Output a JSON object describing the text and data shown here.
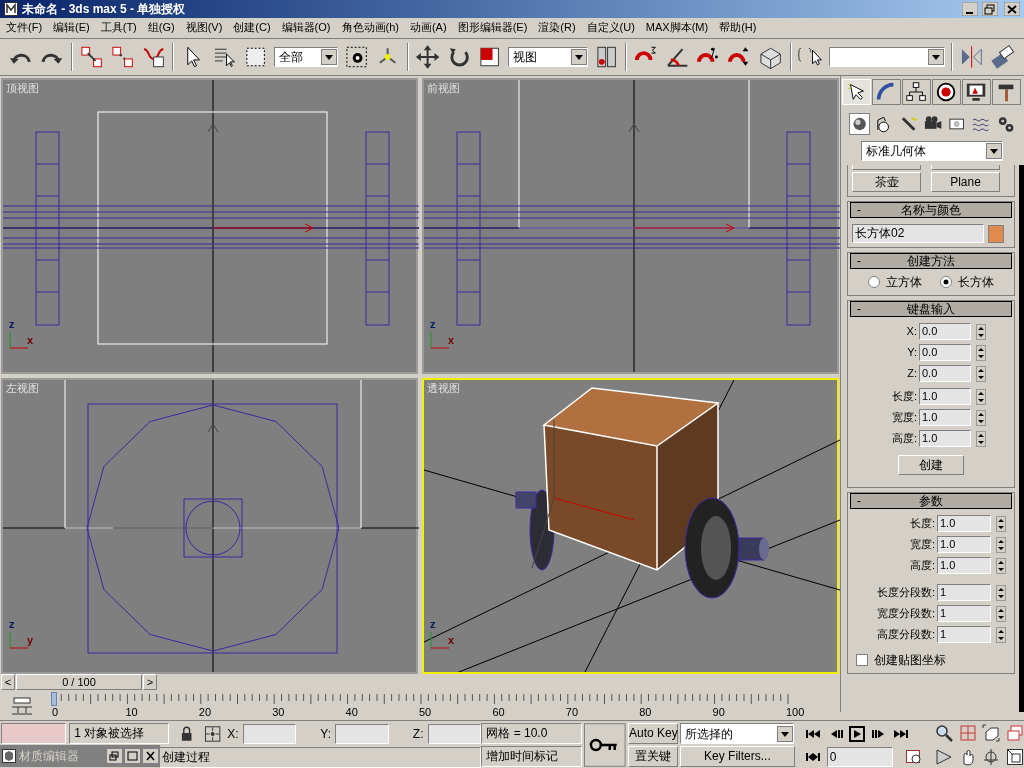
{
  "window": {
    "title": "未命名 - 3ds max 5 - 单独授权"
  },
  "menu": [
    "文件(F)",
    "编辑(E)",
    "工具(T)",
    "组(G)",
    "视图(V)",
    "创建(C)",
    "编辑器(O)",
    "角色动画(h)",
    "动画(A)",
    "图形编辑器(E)",
    "渲染(R)",
    "自定义(U)",
    "MAX脚本(M)",
    "帮助(H)"
  ],
  "toolbar": {
    "selection_filter": "全部",
    "reference_coord": "视图"
  },
  "viewports": [
    {
      "kind": "top",
      "label": "顶视图",
      "active": false,
      "axis_labels": [
        "z",
        "x"
      ]
    },
    {
      "kind": "front",
      "label": "前视图",
      "active": false,
      "axis_labels": [
        "z",
        "x"
      ]
    },
    {
      "kind": "left",
      "label": "左视图",
      "active": false,
      "axis_labels": [
        "z",
        "y"
      ]
    },
    {
      "kind": "perspective",
      "label": "透视图",
      "active": true,
      "axis_labels": [
        "z",
        "x"
      ]
    }
  ],
  "command_panel": {
    "tabs": [
      {
        "selected": true
      },
      {
        "selected": false
      },
      {
        "selected": false
      },
      {
        "selected": false
      },
      {
        "selected": false
      },
      {
        "selected": false
      }
    ],
    "object_types": [
      {
        "selected": true
      },
      {
        "selected": false
      },
      {
        "selected": false
      },
      {
        "selected": false
      },
      {
        "selected": false
      },
      {
        "selected": false
      },
      {
        "selected": false
      }
    ],
    "category": "标准几何体",
    "object_buttons": [
      "茶壶",
      "Plane"
    ],
    "name_rollout": {
      "toggle": "-",
      "title": "名称与颜色",
      "name": "长方体02",
      "color": "#e08a4e"
    },
    "method_rollout": {
      "toggle": "-",
      "title": "创建方法",
      "options": [
        {
          "label": "立方体",
          "selected": false
        },
        {
          "label": "长方体",
          "selected": true
        }
      ]
    },
    "keyboard_rollout": {
      "toggle": "-",
      "title": "键盘输入",
      "fields": [
        {
          "label": "X:",
          "value": "0.0"
        },
        {
          "label": "Y:",
          "value": "0.0"
        },
        {
          "label": "Z:",
          "value": "0.0"
        }
      ],
      "sizes": [
        {
          "label": "长度:",
          "value": "1.0"
        },
        {
          "label": "宽度:",
          "value": "1.0"
        },
        {
          "label": "高度:",
          "value": "1.0"
        }
      ],
      "button": "创建"
    },
    "params_rollout": {
      "toggle": "-",
      "title": "参数",
      "sizes": [
        {
          "label": "长度:",
          "value": "1.0"
        },
        {
          "label": "宽度:",
          "value": "1.0"
        },
        {
          "label": "高度:",
          "value": "1.0"
        }
      ],
      "segments": [
        {
          "label": "长度分段数:",
          "value": "1"
        },
        {
          "label": "宽度分段数:",
          "value": "1"
        },
        {
          "label": "高度分段数:",
          "value": "1"
        }
      ],
      "mapping": {
        "label": "创建贴图坐标",
        "checked": false
      }
    }
  },
  "time_slider": {
    "prev": "<",
    "position": "0 / 100",
    "next": ">"
  },
  "track_labels": [
    "0",
    "10",
    "20",
    "30",
    "40",
    "50",
    "60",
    "70",
    "80",
    "90",
    "100"
  ],
  "status": {
    "selection": "1 对象被选择",
    "x_label": "X:",
    "y_label": "Y:",
    "z_label": "Z:",
    "grid": "网格 = 10.0",
    "prompt": "创建过程",
    "add_time_tag": "增加时间标记",
    "auto_key": "Auto Key",
    "set_key": "置关键",
    "key_mode": "所选择的",
    "key_filters": "Key Filters...",
    "frame": "0"
  },
  "mini_window": {
    "title": "材质编辑器"
  }
}
